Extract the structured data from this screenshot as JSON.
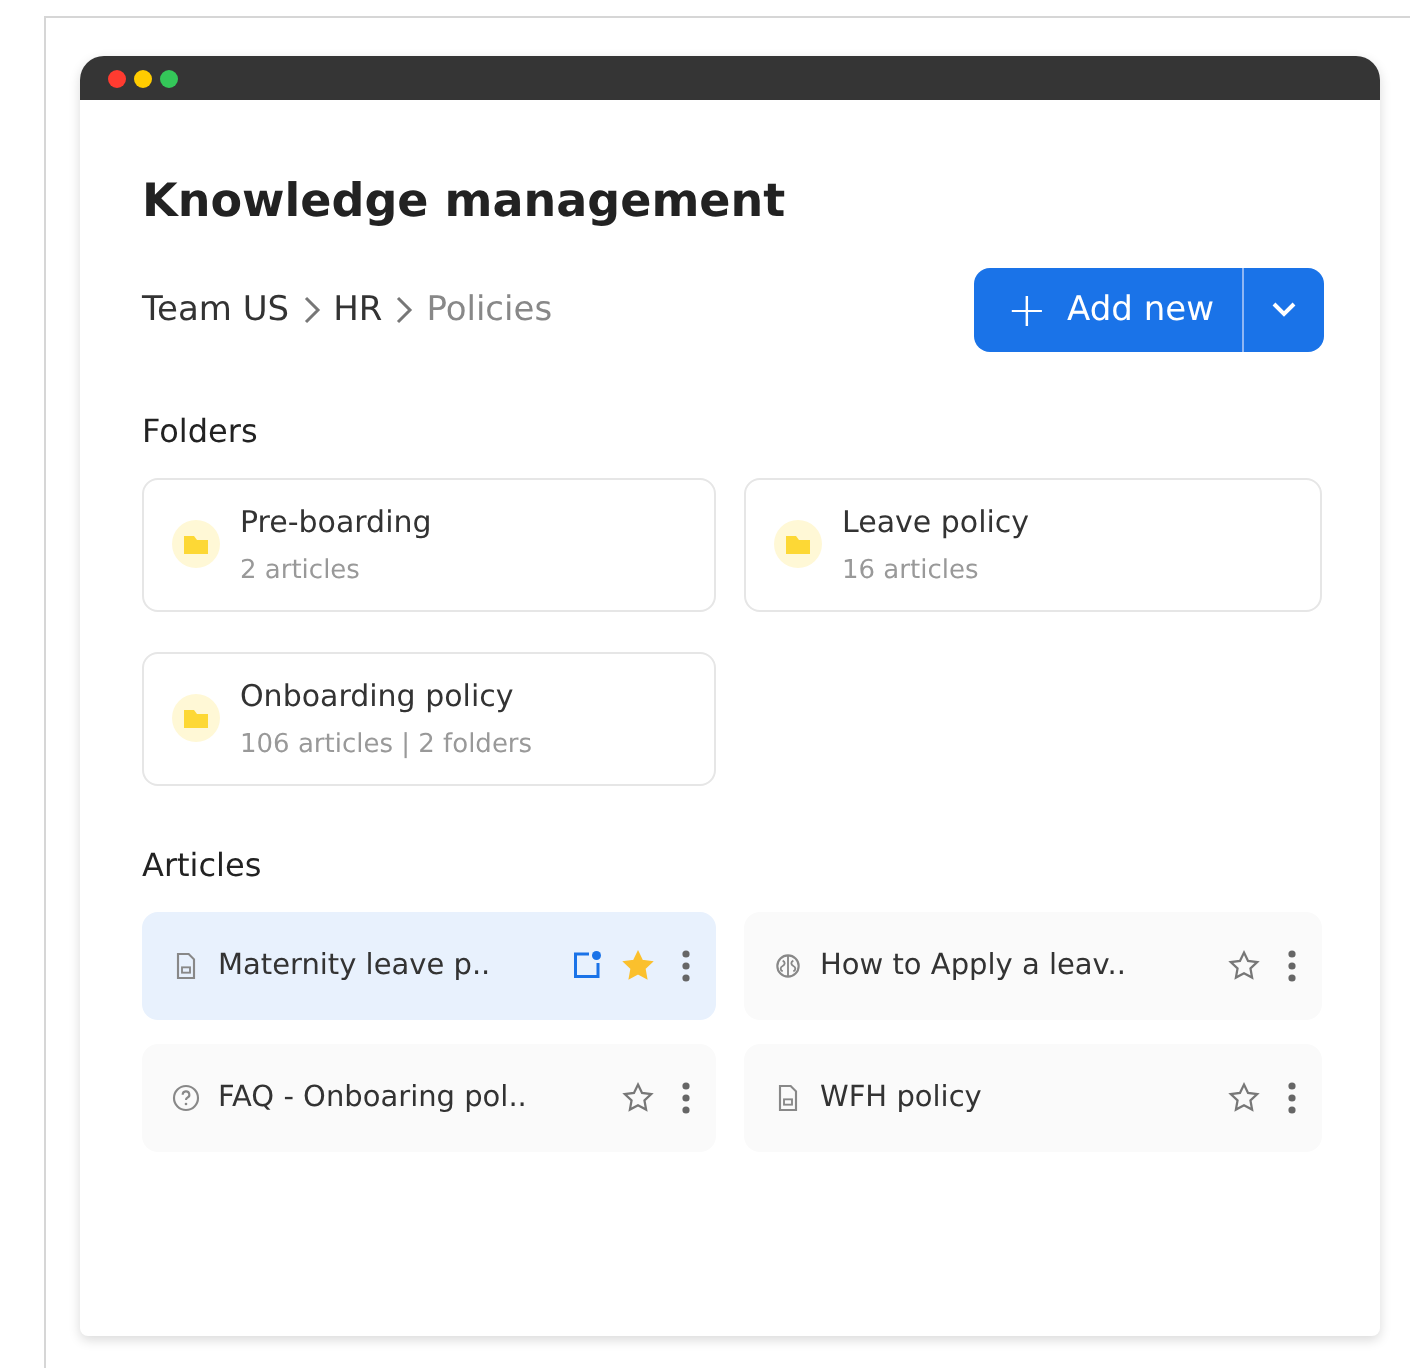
{
  "window": {
    "title": "Knowledge management"
  },
  "breadcrumb": [
    {
      "label": "Team US",
      "current": false
    },
    {
      "label": "HR",
      "current": false
    },
    {
      "label": "Policies",
      "current": true
    }
  ],
  "add_button": {
    "plus": "+",
    "label": "Add new"
  },
  "folders_heading": "Folders",
  "folders": [
    {
      "name": "Pre-boarding",
      "meta": "2 articles"
    },
    {
      "name": "Leave policy",
      "meta": "16 articles"
    },
    {
      "name": "Onboarding policy",
      "meta": "106 articles | 2 folders"
    }
  ],
  "articles_heading": "Articles",
  "articles": [
    {
      "title": "Maternity leave p..",
      "kind": "document",
      "selected": true,
      "edited": true,
      "starred": true
    },
    {
      "title": "How to Apply a leav..",
      "kind": "brain",
      "selected": false,
      "edited": false,
      "starred": false
    },
    {
      "title": "FAQ - Onboaring pol..",
      "kind": "help",
      "selected": false,
      "edited": false,
      "starred": false
    },
    {
      "title": "WFH policy",
      "kind": "document",
      "selected": false,
      "edited": false,
      "starred": false
    }
  ]
}
